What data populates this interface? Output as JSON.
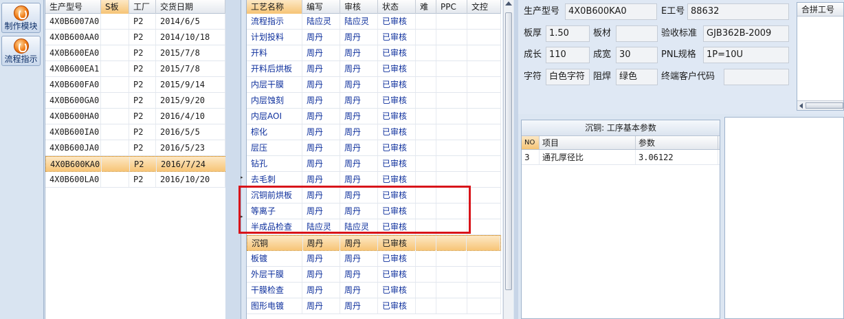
{
  "toolbar": {
    "buttons": [
      {
        "label": "制作模块",
        "icon": "flame-icon"
      },
      {
        "label": "流程指示",
        "icon": "flame-icon"
      }
    ]
  },
  "products": {
    "columns": [
      "生产型号",
      "S板",
      "工厂",
      "交货日期"
    ],
    "rows": [
      {
        "model": "4X0B6007A0",
        "s": "",
        "factory": "P2",
        "date": "2014/6/5"
      },
      {
        "model": "4X0B600AA0",
        "s": "",
        "factory": "P2",
        "date": "2014/10/18"
      },
      {
        "model": "4X0B600EA0",
        "s": "",
        "factory": "P2",
        "date": "2015/7/8"
      },
      {
        "model": "4X0B600EA1",
        "s": "",
        "factory": "P2",
        "date": "2015/7/8"
      },
      {
        "model": "4X0B600FA0",
        "s": "",
        "factory": "P2",
        "date": "2015/9/14"
      },
      {
        "model": "4X0B600GA0",
        "s": "",
        "factory": "P2",
        "date": "2015/9/20"
      },
      {
        "model": "4X0B600HA0",
        "s": "",
        "factory": "P2",
        "date": "2016/4/10"
      },
      {
        "model": "4X0B600IA0",
        "s": "",
        "factory": "P2",
        "date": "2016/5/5"
      },
      {
        "model": "4X0B600JA0",
        "s": "",
        "factory": "P2",
        "date": "2016/5/23"
      },
      {
        "model": "4X0B600KA0",
        "s": "",
        "factory": "P2",
        "date": "2016/7/24"
      },
      {
        "model": "4X0B600LA0",
        "s": "",
        "factory": "P2",
        "date": "2016/10/20"
      }
    ],
    "selected_index": 9
  },
  "process": {
    "columns": [
      "工艺名称",
      "编写",
      "审核",
      "状态",
      "难",
      "PPC",
      "文控"
    ],
    "rows": [
      {
        "name": "流程指示",
        "author": "陆应灵",
        "reviewer": "陆应灵",
        "status": "已审核"
      },
      {
        "name": "计划投料",
        "author": "周丹",
        "reviewer": "周丹",
        "status": "已审核"
      },
      {
        "name": "开料",
        "author": "周丹",
        "reviewer": "周丹",
        "status": "已审核"
      },
      {
        "name": "开料后烘板",
        "author": "周丹",
        "reviewer": "周丹",
        "status": "已审核"
      },
      {
        "name": "内层干膜",
        "author": "周丹",
        "reviewer": "周丹",
        "status": "已审核"
      },
      {
        "name": "内层蚀刻",
        "author": "周丹",
        "reviewer": "周丹",
        "status": "已审核"
      },
      {
        "name": "内层AOI",
        "author": "周丹",
        "reviewer": "周丹",
        "status": "已审核"
      },
      {
        "name": "棕化",
        "author": "周丹",
        "reviewer": "周丹",
        "status": "已审核"
      },
      {
        "name": "层压",
        "author": "周丹",
        "reviewer": "周丹",
        "status": "已审核"
      },
      {
        "name": "钻孔",
        "author": "周丹",
        "reviewer": "周丹",
        "status": "已审核"
      },
      {
        "name": "去毛刺",
        "author": "周丹",
        "reviewer": "周丹",
        "status": "已审核"
      },
      {
        "name": "沉铜前烘板",
        "author": "周丹",
        "reviewer": "周丹",
        "status": "已审核"
      },
      {
        "name": "等离子",
        "author": "周丹",
        "reviewer": "周丹",
        "status": "已审核"
      },
      {
        "name": "半成品检查",
        "author": "陆应灵",
        "reviewer": "陆应灵",
        "status": "已审核"
      },
      {
        "name": "沉铜",
        "author": "周丹",
        "reviewer": "周丹",
        "status": "已审核"
      },
      {
        "name": "板镀",
        "author": "周丹",
        "reviewer": "周丹",
        "status": "已审核"
      },
      {
        "name": "外层干膜",
        "author": "周丹",
        "reviewer": "周丹",
        "status": "已审核"
      },
      {
        "name": "干膜检查",
        "author": "周丹",
        "reviewer": "周丹",
        "status": "已审核"
      },
      {
        "name": "图形电镀",
        "author": "周丹",
        "reviewer": "周丹",
        "status": "已审核"
      }
    ],
    "selected_index": 14
  },
  "info": {
    "model_label": "生产型号",
    "model_value": "4X0B600KA0",
    "eno_label": "E工号",
    "eno_value": "88632",
    "thickness_label": "板厚",
    "thickness_value": "1.50",
    "material_label": "板材",
    "material_value": "",
    "standard_label": "验收标准",
    "standard_value": "GJB362B-2009",
    "length_label": "成长",
    "length_value": "110",
    "width_label": "成宽",
    "width_value": "30",
    "pnl_label": "PNL规格",
    "pnl_value": "1P=10U",
    "char_label": "字符",
    "char_value": "白色字符",
    "mask_label": "阻焊",
    "mask_value": "绿色",
    "customer_label": "终端客户代码",
    "customer_value": ""
  },
  "merge": {
    "header": "合拼工号"
  },
  "params": {
    "title": "沉铜: 工序基本参数",
    "columns": [
      "NO",
      "项目",
      "参数"
    ],
    "rows": [
      {
        "no": "3",
        "item": "通孔厚径比",
        "value": "3.06122"
      }
    ]
  },
  "colors": {
    "selection": "#f7c577",
    "highlight_box": "#d8141a",
    "link_text": "#0d2f9c"
  }
}
